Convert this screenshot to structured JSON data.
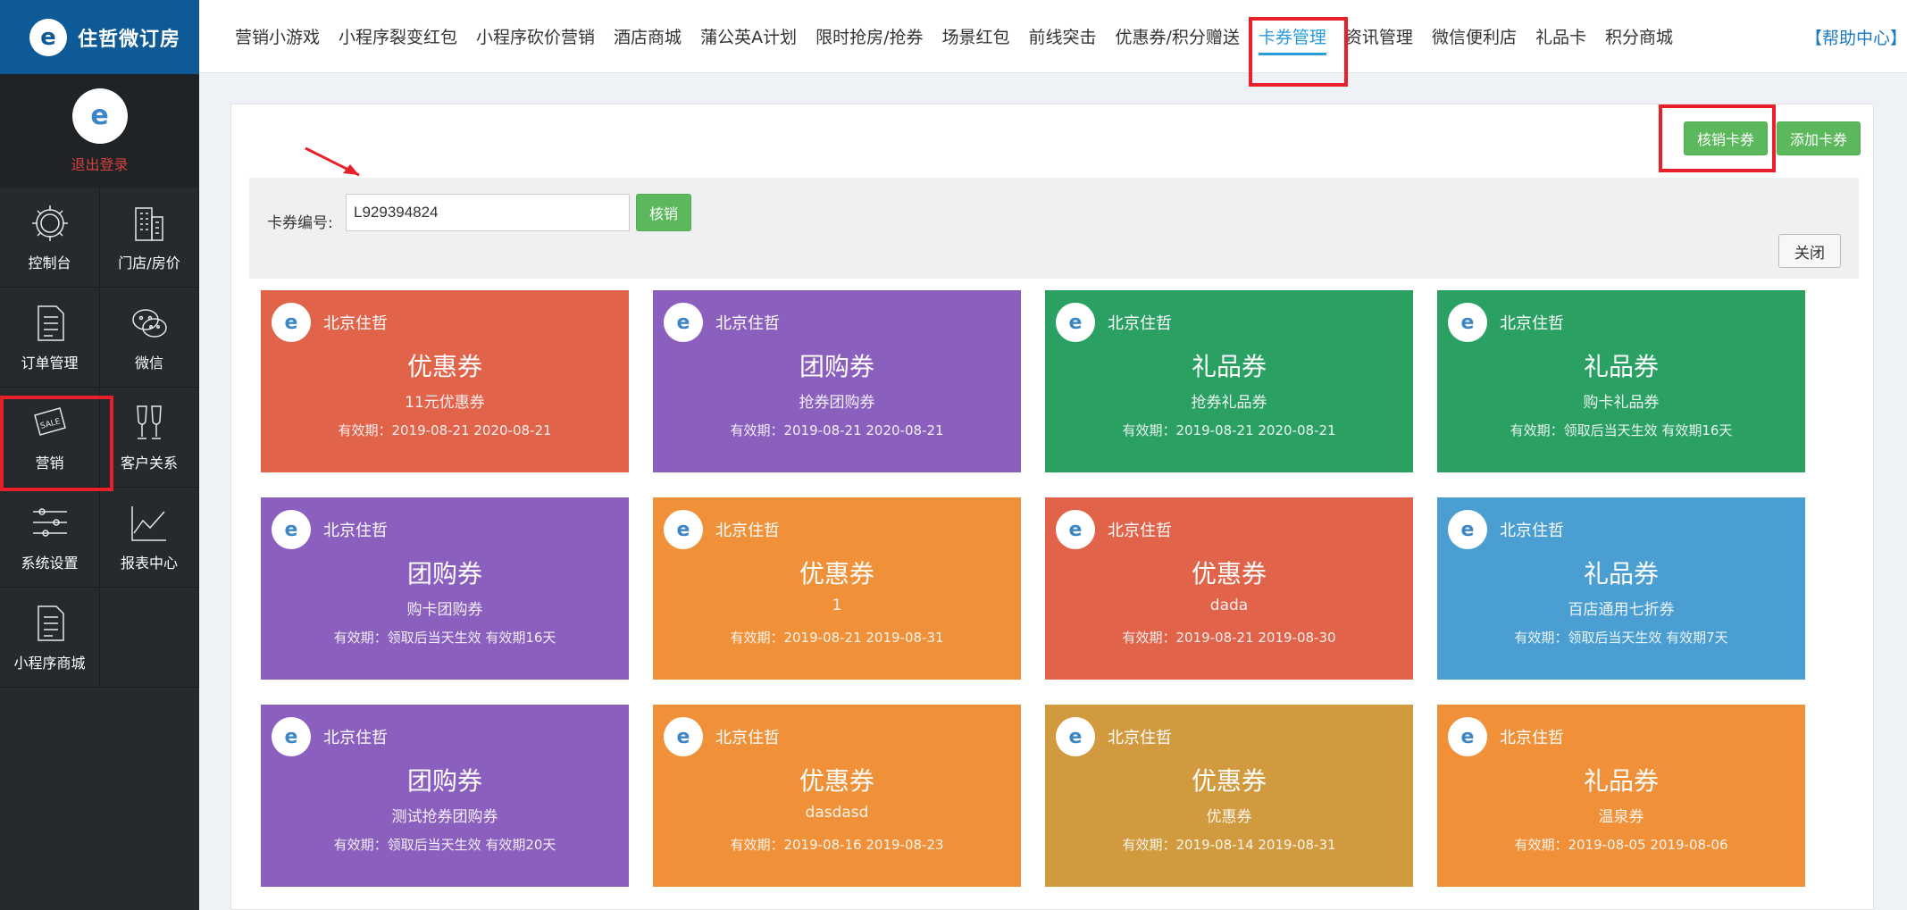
{
  "brand": {
    "name": "住哲微订房"
  },
  "profile": {
    "logout": "退出登录"
  },
  "sidebar": {
    "items": [
      {
        "label": "控制台",
        "icon": "gear-icon"
      },
      {
        "label": "门店/房价",
        "icon": "building-icon"
      },
      {
        "label": "订单管理",
        "icon": "document-icon"
      },
      {
        "label": "微信",
        "icon": "wechat-icon"
      },
      {
        "label": "营销",
        "icon": "sale-tag-icon"
      },
      {
        "label": "客户关系",
        "icon": "glasses-icon"
      },
      {
        "label": "系统设置",
        "icon": "sliders-icon"
      },
      {
        "label": "报表中心",
        "icon": "chart-icon"
      },
      {
        "label": "小程序商城",
        "icon": "document-icon"
      }
    ]
  },
  "topnav": {
    "tabs": [
      "营销小游戏",
      "小程序裂变红包",
      "小程序砍价营销",
      "酒店商城",
      "蒲公英A计划",
      "限时抢房/抢券",
      "场景红包",
      "前线突击",
      "优惠券/积分赠送",
      "卡券管理",
      "资讯管理",
      "微信便利店",
      "礼品卡",
      "积分商城"
    ],
    "active_index": 9,
    "help": "【帮助中心】"
  },
  "actions": {
    "redeem_coupon": "核销卡券",
    "add_coupon": "添加卡券"
  },
  "redeem": {
    "label": "卡券编号:",
    "value": "L929394824",
    "button": "核销",
    "close": "关闭"
  },
  "cards": [
    {
      "merchant": "北京住哲",
      "type": "优惠券",
      "name": "11元优惠券",
      "valid": "有效期：2019-08-21 2020-08-21",
      "color": "#e0634a"
    },
    {
      "merchant": "北京住哲",
      "type": "团购券",
      "name": "抢券团购券",
      "valid": "有效期：2019-08-21 2020-08-21",
      "color": "#8a5fbd"
    },
    {
      "merchant": "北京住哲",
      "type": "礼品券",
      "name": "抢券礼品券",
      "valid": "有效期：2019-08-21 2020-08-21",
      "color": "#2aa163"
    },
    {
      "merchant": "北京住哲",
      "type": "礼品券",
      "name": "购卡礼品券",
      "valid": "有效期：领取后当天生效 有效期16天",
      "color": "#2aa163"
    },
    {
      "merchant": "北京住哲",
      "type": "团购券",
      "name": "购卡团购券",
      "valid": "有效期：领取后当天生效 有效期16天",
      "color": "#8a5fbd"
    },
    {
      "merchant": "北京住哲",
      "type": "优惠券",
      "name": "1",
      "valid": "有效期：2019-08-21 2019-08-31",
      "color": "#f0913a"
    },
    {
      "merchant": "北京住哲",
      "type": "优惠券",
      "name": "dada",
      "valid": "有效期：2019-08-21 2019-08-30",
      "color": "#e0634a"
    },
    {
      "merchant": "北京住哲",
      "type": "礼品券",
      "name": "百店通用七折券",
      "valid": "有效期：领取后当天生效 有效期7天",
      "color": "#4a9ed1"
    },
    {
      "merchant": "北京住哲",
      "type": "团购券",
      "name": "测试抢券团购券",
      "valid": "有效期：领取后当天生效 有效期20天",
      "color": "#8a5fbd"
    },
    {
      "merchant": "北京住哲",
      "type": "优惠券",
      "name": "dasdasd",
      "valid": "有效期：2019-08-16 2019-08-23",
      "color": "#f0913a"
    },
    {
      "merchant": "北京住哲",
      "type": "优惠券",
      "name": "优惠券",
      "valid": "有效期：2019-08-14 2019-08-31",
      "color": "#d19a3e"
    },
    {
      "merchant": "北京住哲",
      "type": "礼品券",
      "name": "温泉券",
      "valid": "有效期：2019-08-05 2019-08-06",
      "color": "#f0913a"
    }
  ],
  "colors": {
    "sidebar": "#262a2e",
    "logo_bg": "#0e5a97",
    "accent": "#2b9ad8",
    "success": "#5cb85c",
    "highlight": "#e8202a"
  }
}
